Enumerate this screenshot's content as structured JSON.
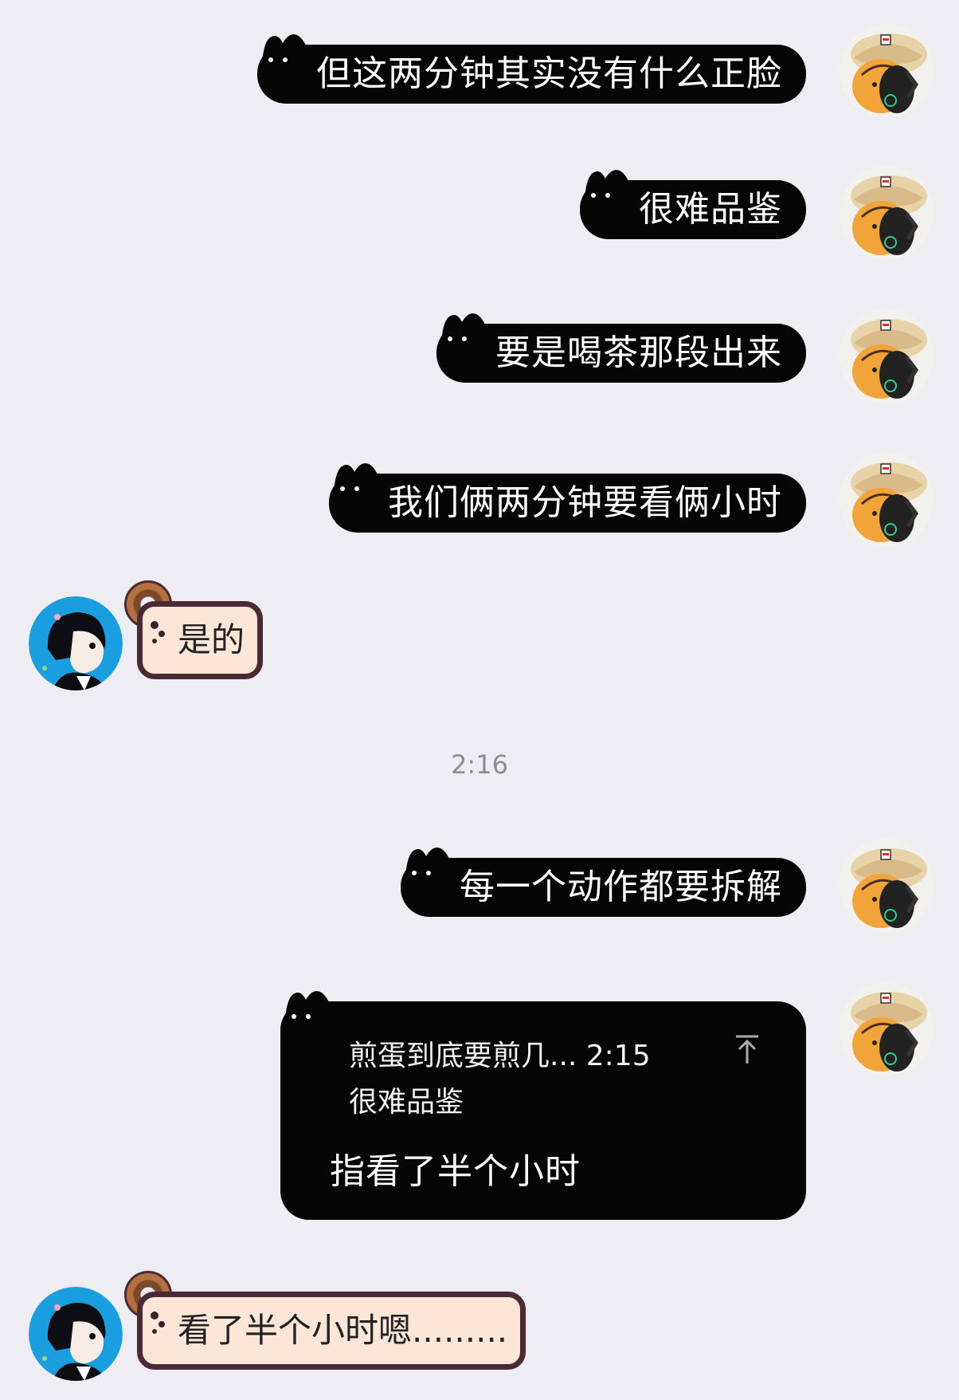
{
  "messages": [
    {
      "side": "right",
      "text": "但这两分钟其实没有什么正脸"
    },
    {
      "side": "right",
      "text": "很难品鉴"
    },
    {
      "side": "right",
      "text": "要是喝茶那段出来"
    },
    {
      "side": "right",
      "text": "我们俩两分钟要看俩小时"
    },
    {
      "side": "left",
      "text": "是的"
    },
    {
      "side": "right",
      "text": "每一个动作都要拆解"
    },
    {
      "side": "left",
      "text": "看了半个小时嗯........."
    }
  ],
  "timestamp": "2:16",
  "reply": {
    "quote_title": "煎蛋到底要煎几... 2:15",
    "quote_text": "很难品鉴",
    "text": "指看了半个小时"
  },
  "icons": {
    "right_avatar": "capybara-chef-avatar-icon",
    "left_avatar": "anime-boy-avatar-icon",
    "reply_arrow": "jump-to-original-arrow-icon",
    "left_decor": "donut-icon"
  },
  "colors": {
    "background": "#ededf2",
    "right_bubble": "#050505",
    "left_bubble": "#fbe6d8",
    "left_bubble_border": "#4a2a35",
    "timestamp": "#8c8c93"
  }
}
